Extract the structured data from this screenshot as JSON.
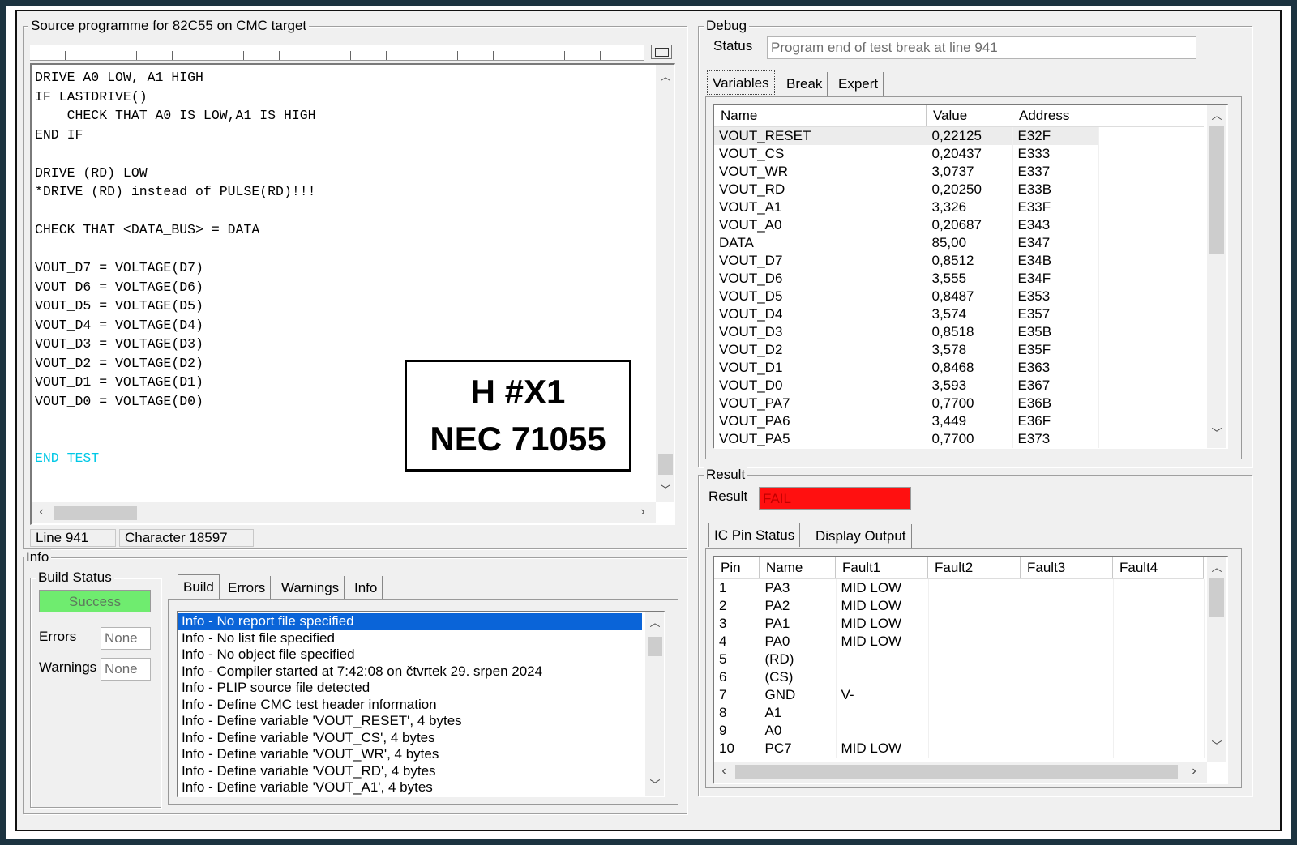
{
  "source": {
    "title": "Source programme for 82C55 on CMC target",
    "code_lines": [
      "DRIVE A0 LOW, A1 HIGH",
      "IF LASTDRIVE()",
      "    CHECK THAT A0 IS LOW,A1 IS HIGH",
      "END IF",
      "",
      "DRIVE (RD) LOW",
      "*DRIVE (RD) instead of PULSE(RD)!!!",
      "",
      "CHECK THAT <DATA_BUS> = DATA",
      "",
      "VOUT_D7 = VOLTAGE(D7)",
      "VOUT_D6 = VOLTAGE(D6)",
      "VOUT_D5 = VOLTAGE(D5)",
      "VOUT_D4 = VOLTAGE(D4)",
      "VOUT_D3 = VOLTAGE(D3)",
      "VOUT_D2 = VOLTAGE(D2)",
      "VOUT_D1 = VOLTAGE(D1)",
      "VOUT_D0 = VOLTAGE(D0)",
      "",
      "",
      "END TEST"
    ],
    "status_line": "Line 941",
    "status_char": "Character 18597",
    "overlay_line1": "H #X1",
    "overlay_line2": "NEC 71055"
  },
  "info": {
    "title": "Info",
    "build_status_label": "Build Status",
    "build_status_value": "Success",
    "errors_label": "Errors",
    "errors_value": "None",
    "warnings_label": "Warnings",
    "warnings_value": "None",
    "tabs": [
      "Build",
      "Errors",
      "Warnings",
      "Info"
    ],
    "log": [
      "Info - No report file specified",
      "Info - No list file specified",
      "Info - No object file specified",
      "Info - Compiler started at 7:42:08 on čtvrtek 29. srpen 2024",
      "Info - PLIP source file detected",
      "Info - Define CMC test header information",
      "Info - Define variable 'VOUT_RESET', 4 bytes",
      "Info - Define variable 'VOUT_CS', 4 bytes",
      "Info - Define variable 'VOUT_WR', 4 bytes",
      "Info - Define variable 'VOUT_RD', 4 bytes",
      "Info - Define variable 'VOUT_A1', 4 bytes"
    ]
  },
  "debug": {
    "title": "Debug",
    "status_label": "Status",
    "status_value": "Program end of test break at line 941",
    "tabs": [
      "Variables",
      "Break",
      "Expert"
    ],
    "columns": [
      "Name",
      "Value",
      "Address"
    ],
    "rows": [
      [
        "VOUT_RESET",
        "0,22125",
        "E32F"
      ],
      [
        "VOUT_CS",
        "0,20437",
        "E333"
      ],
      [
        "VOUT_WR",
        "3,0737",
        "E337"
      ],
      [
        "VOUT_RD",
        "0,20250",
        "E33B"
      ],
      [
        "VOUT_A1",
        "3,326",
        "E33F"
      ],
      [
        "VOUT_A0",
        "0,20687",
        "E343"
      ],
      [
        "DATA",
        "85,00",
        "E347"
      ],
      [
        "VOUT_D7",
        "0,8512",
        "E34B"
      ],
      [
        "VOUT_D6",
        "3,555",
        "E34F"
      ],
      [
        "VOUT_D5",
        "0,8487",
        "E353"
      ],
      [
        "VOUT_D4",
        "3,574",
        "E357"
      ],
      [
        "VOUT_D3",
        "0,8518",
        "E35B"
      ],
      [
        "VOUT_D2",
        "3,578",
        "E35F"
      ],
      [
        "VOUT_D1",
        "0,8468",
        "E363"
      ],
      [
        "VOUT_D0",
        "3,593",
        "E367"
      ],
      [
        "VOUT_PA7",
        "0,7700",
        "E36B"
      ],
      [
        "VOUT_PA6",
        "3,449",
        "E36F"
      ],
      [
        "VOUT_PA5",
        "0,7700",
        "E373"
      ]
    ]
  },
  "result": {
    "title": "Result",
    "label": "Result",
    "value": "FAIL",
    "tabs": [
      "IC Pin Status",
      "Display Output"
    ],
    "columns": [
      "Pin",
      "Name",
      "Fault1",
      "Fault2",
      "Fault3",
      "Fault4"
    ],
    "rows": [
      [
        "1",
        "PA3",
        "MID LOW",
        "",
        "",
        ""
      ],
      [
        "2",
        "PA2",
        "MID LOW",
        "",
        "",
        ""
      ],
      [
        "3",
        "PA1",
        "MID LOW",
        "",
        "",
        ""
      ],
      [
        "4",
        "PA0",
        "MID LOW",
        "",
        "",
        ""
      ],
      [
        "5",
        "(RD)",
        "",
        "",
        "",
        ""
      ],
      [
        "6",
        "(CS)",
        "",
        "",
        "",
        ""
      ],
      [
        "7",
        "GND",
        "V-",
        "",
        "",
        ""
      ],
      [
        "8",
        "A1",
        "",
        "",
        "",
        ""
      ],
      [
        "9",
        "A0",
        "",
        "",
        "",
        ""
      ],
      [
        "10",
        "PC7",
        "MID LOW",
        "",
        "",
        ""
      ]
    ]
  },
  "colors": {
    "fail": "#ff1010",
    "success": "#6fec6f",
    "selection": "#0a64d8",
    "end_test": "#00c8e6"
  }
}
